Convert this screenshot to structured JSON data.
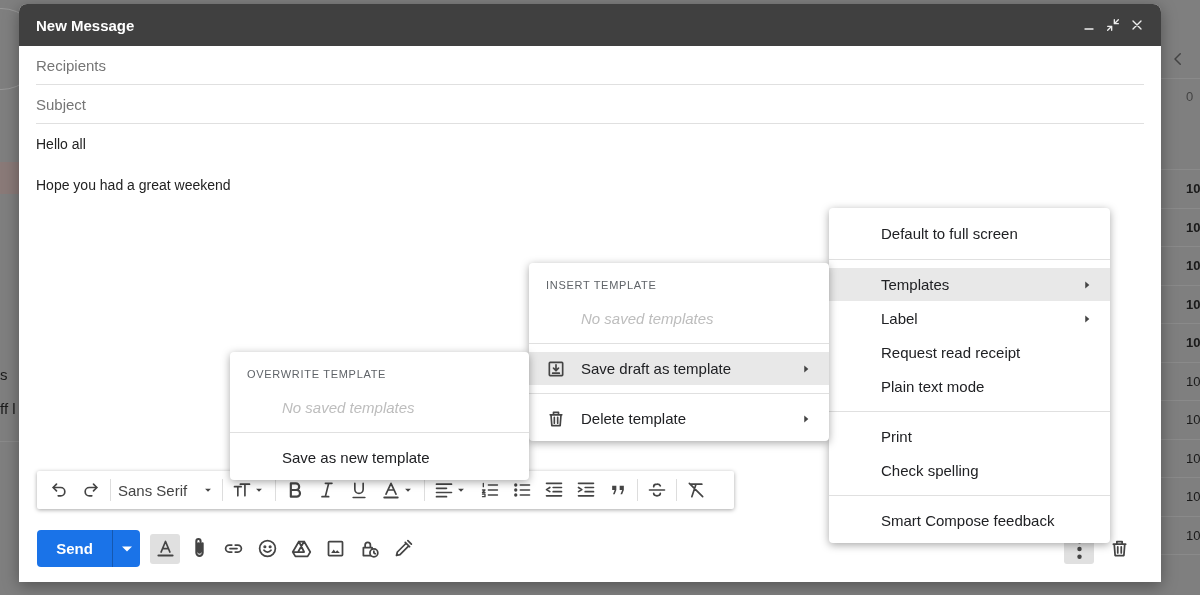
{
  "background": {
    "left_fragments": [
      "s",
      "ff l"
    ],
    "right_column": [
      {
        "text": "0",
        "bold": false
      },
      {
        "text": "10",
        "bold": true
      },
      {
        "text": "10",
        "bold": true
      },
      {
        "text": "10",
        "bold": true
      },
      {
        "text": "10",
        "bold": true
      },
      {
        "text": "10",
        "bold": true
      },
      {
        "text": "10",
        "bold": false
      },
      {
        "text": "10",
        "bold": false
      },
      {
        "text": "10",
        "bold": false
      },
      {
        "text": "10",
        "bold": false
      },
      {
        "text": "10",
        "bold": false
      }
    ]
  },
  "compose": {
    "title": "New Message",
    "recipients": {
      "placeholder": "Recipients"
    },
    "subject": {
      "placeholder": "Subject"
    },
    "body": [
      "Hello all",
      "Hope you had a great weekend"
    ],
    "font_menu": "Sans Serif",
    "send_label": "Send",
    "formatting_on": true,
    "more_open": true
  },
  "more_menu": [
    {
      "kind": "item",
      "label": "Default to full screen",
      "selected": false,
      "submenu": false
    },
    {
      "kind": "divider"
    },
    {
      "kind": "item",
      "label": "Templates",
      "selected": true,
      "submenu": true
    },
    {
      "kind": "item",
      "label": "Label",
      "selected": false,
      "submenu": true
    },
    {
      "kind": "item",
      "label": "Request read receipt",
      "selected": false,
      "submenu": false
    },
    {
      "kind": "item",
      "label": "Plain text mode",
      "selected": false,
      "submenu": false
    },
    {
      "kind": "divider"
    },
    {
      "kind": "item",
      "label": "Print",
      "selected": false,
      "submenu": false
    },
    {
      "kind": "item",
      "label": "Check spelling",
      "selected": false,
      "submenu": false
    },
    {
      "kind": "divider"
    },
    {
      "kind": "item",
      "label": "Smart Compose feedback",
      "selected": false,
      "submenu": false
    }
  ],
  "templates_menu": [
    {
      "kind": "header",
      "label": "INSERT TEMPLATE"
    },
    {
      "kind": "empty",
      "label": "No saved templates"
    },
    {
      "kind": "divider"
    },
    {
      "kind": "save",
      "label": "Save draft as template",
      "selected": true,
      "submenu": true
    },
    {
      "kind": "divider"
    },
    {
      "kind": "delete",
      "label": "Delete template",
      "selected": false,
      "submenu": true
    }
  ],
  "overwrite_menu": [
    {
      "kind": "header",
      "label": "OVERWRITE TEMPLATE"
    },
    {
      "kind": "empty",
      "label": "No saved templates"
    },
    {
      "kind": "divider"
    },
    {
      "kind": "item",
      "label": "Save as new template",
      "selected": false,
      "submenu": false
    }
  ]
}
